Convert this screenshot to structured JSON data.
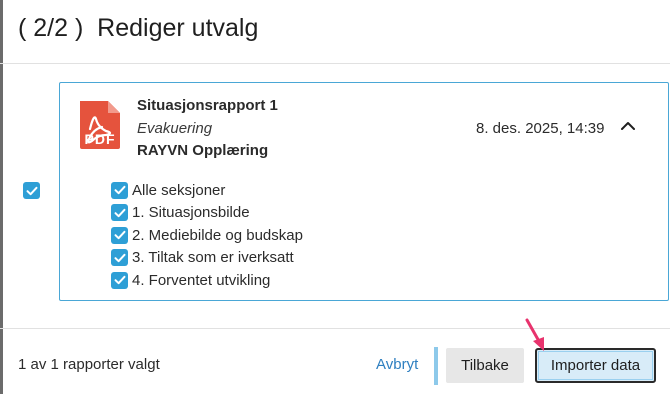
{
  "dialog": {
    "title": "( 2/2 )  Rediger utvalg"
  },
  "report": {
    "file_type": "PDF",
    "title": "Situasjonsrapport 1",
    "subtitle": "Evakuering",
    "organization": "RAYVN Opplæring",
    "datetime": "8. des. 2025, 14:39",
    "selected": true,
    "expanded": true,
    "sections": [
      {
        "label": "Alle seksjoner",
        "checked": true
      },
      {
        "label": "1. Situasjonsbilde",
        "checked": true
      },
      {
        "label": "2. Mediebilde og budskap",
        "checked": true
      },
      {
        "label": "3. Tiltak som er iverksatt",
        "checked": true
      },
      {
        "label": "4. Forventet utvikling",
        "checked": true
      }
    ]
  },
  "footer": {
    "status": "1 av 1 rapporter valgt",
    "cancel_label": "Avbryt",
    "back_label": "Tilbake",
    "import_label": "Importer data"
  },
  "colors": {
    "accent": "#2e9fd6",
    "card_border": "#4aa7d6",
    "pdf_icon": "#e5533d",
    "link": "#2e7fc0",
    "arrow": "#e8336d"
  },
  "icons": {
    "pdf": "pdf-file-icon",
    "collapse": "chevron-up-icon",
    "check": "check-icon",
    "pointer": "annotation-arrow-icon"
  }
}
